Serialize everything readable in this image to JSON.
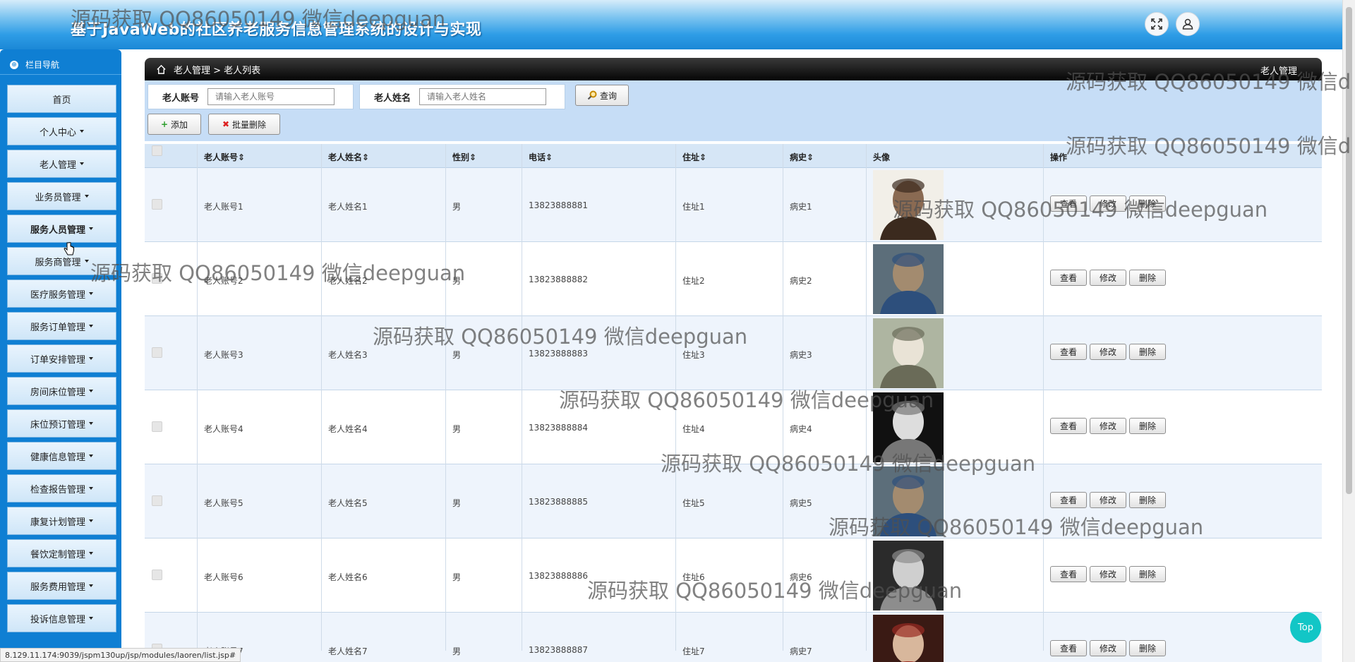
{
  "header": {
    "title": "基于JavaWeb的社区养老服务信息管理系统的设计与实现"
  },
  "sidebar": {
    "title": "栏目导航",
    "items": [
      {
        "label": "首页",
        "dropdown": false
      },
      {
        "label": "个人中心",
        "dropdown": true
      },
      {
        "label": "老人管理",
        "dropdown": true
      },
      {
        "label": "业务员管理",
        "dropdown": true
      },
      {
        "label": "服务人员管理",
        "dropdown": true
      },
      {
        "label": "服务商管理",
        "dropdown": true
      },
      {
        "label": "医疗服务管理",
        "dropdown": true
      },
      {
        "label": "服务订单管理",
        "dropdown": true
      },
      {
        "label": "订单安排管理",
        "dropdown": true
      },
      {
        "label": "房间床位管理",
        "dropdown": true
      },
      {
        "label": "床位预订管理",
        "dropdown": true
      },
      {
        "label": "健康信息管理",
        "dropdown": true
      },
      {
        "label": "检查报告管理",
        "dropdown": true
      },
      {
        "label": "康复计划管理",
        "dropdown": true
      },
      {
        "label": "餐饮定制管理",
        "dropdown": true
      },
      {
        "label": "服务费用管理",
        "dropdown": true
      },
      {
        "label": "投诉信息管理",
        "dropdown": true
      }
    ]
  },
  "breadcrumb": {
    "path": "老人管理 > 老人列表",
    "right": "老人管理"
  },
  "search": {
    "account_label": "老人账号",
    "account_placeholder": "请输入老人账号",
    "name_label": "老人姓名",
    "name_placeholder": "请输入老人姓名",
    "query_button": "查询"
  },
  "actions": {
    "add": "添加",
    "batch_delete": "批量删除"
  },
  "table": {
    "columns": [
      "老人账号",
      "老人姓名",
      "性别",
      "电话",
      "住址",
      "病史",
      "头像",
      "操作"
    ],
    "sortable": [
      "老人账号",
      "老人姓名",
      "性别",
      "电话",
      "住址",
      "病史"
    ],
    "row_buttons": {
      "view": "查看",
      "edit": "修改",
      "delete": "删除"
    },
    "rows": [
      {
        "account": "老人账号1",
        "name": "老人姓名1",
        "gender": "男",
        "phone": "13823888881",
        "address": "住址1",
        "history": "病史1"
      },
      {
        "account": "老人账号2",
        "name": "老人姓名2",
        "gender": "男",
        "phone": "13823888882",
        "address": "住址2",
        "history": "病史2"
      },
      {
        "account": "老人账号3",
        "name": "老人姓名3",
        "gender": "男",
        "phone": "13823888883",
        "address": "住址3",
        "history": "病史3"
      },
      {
        "account": "老人账号4",
        "name": "老人姓名4",
        "gender": "男",
        "phone": "13823888884",
        "address": "住址4",
        "history": "病史4"
      },
      {
        "account": "老人账号5",
        "name": "老人姓名5",
        "gender": "男",
        "phone": "13823888885",
        "address": "住址5",
        "history": "病史5"
      },
      {
        "account": "老人账号6",
        "name": "老人姓名6",
        "gender": "男",
        "phone": "13823888886",
        "address": "住址6",
        "history": "病史6"
      },
      {
        "account": "老人账号7",
        "name": "老人姓名7",
        "gender": "男",
        "phone": "13823888887",
        "address": "住址7",
        "history": "病史7"
      }
    ]
  },
  "watermark": "源码获取 QQ86050149 微信deepguan",
  "watermark_top": "源码获取 QQ86050149 微信deepguan",
  "watermark_right": "源码获取 QQ86050149 微信d",
  "status_url": "8.129.11.174:9039/jspm130up/jsp/modules/laoren/list.jsp#",
  "top_button": "Top"
}
